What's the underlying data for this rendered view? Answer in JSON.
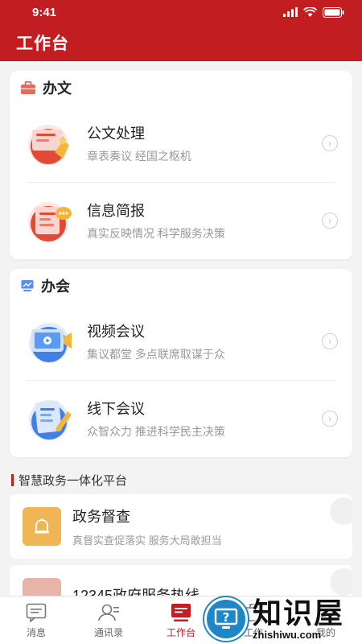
{
  "status_bar": {
    "time": "9:41"
  },
  "app_bar": {
    "title": "工作台"
  },
  "office_doc": {
    "header": "办文",
    "items": [
      {
        "title": "公文处理",
        "subtitle": "章表奏议 经国之枢机",
        "icon": "document-processing-icon"
      },
      {
        "title": "信息简报",
        "subtitle": "真实反映情况 科学服务决策",
        "icon": "info-briefing-icon"
      }
    ]
  },
  "office_meeting": {
    "header": "办会",
    "items": [
      {
        "title": "视频会议",
        "subtitle": "集议都堂 多点联席取谋于众",
        "icon": "video-conference-icon"
      },
      {
        "title": "线下会议",
        "subtitle": "众智众力 推进科学民主决策",
        "icon": "offline-meeting-icon"
      }
    ]
  },
  "platform": {
    "title": "智慧政务一体化平台",
    "items": [
      {
        "title": "政务督查",
        "subtitle": "真督实查促落实 服务大局敢担当",
        "icon_color": "#f0b554"
      },
      {
        "title": "12345政府服务热线",
        "subtitle": "",
        "icon_color": "#e8b3a8"
      }
    ]
  },
  "tabs": [
    {
      "label": "消息",
      "icon": "message-icon",
      "active": false
    },
    {
      "label": "通讯录",
      "icon": "contacts-icon",
      "active": false
    },
    {
      "label": "工作台",
      "icon": "workbench-icon",
      "active": true
    },
    {
      "label": "工作",
      "icon": "work-icon",
      "active": false
    },
    {
      "label": "我的",
      "icon": "profile-icon",
      "active": false
    }
  ],
  "watermark": {
    "cn": "知识屋",
    "en": "zhishiwu.com"
  },
  "colors": {
    "primary": "#c21d21",
    "background": "#f3f3f3"
  }
}
